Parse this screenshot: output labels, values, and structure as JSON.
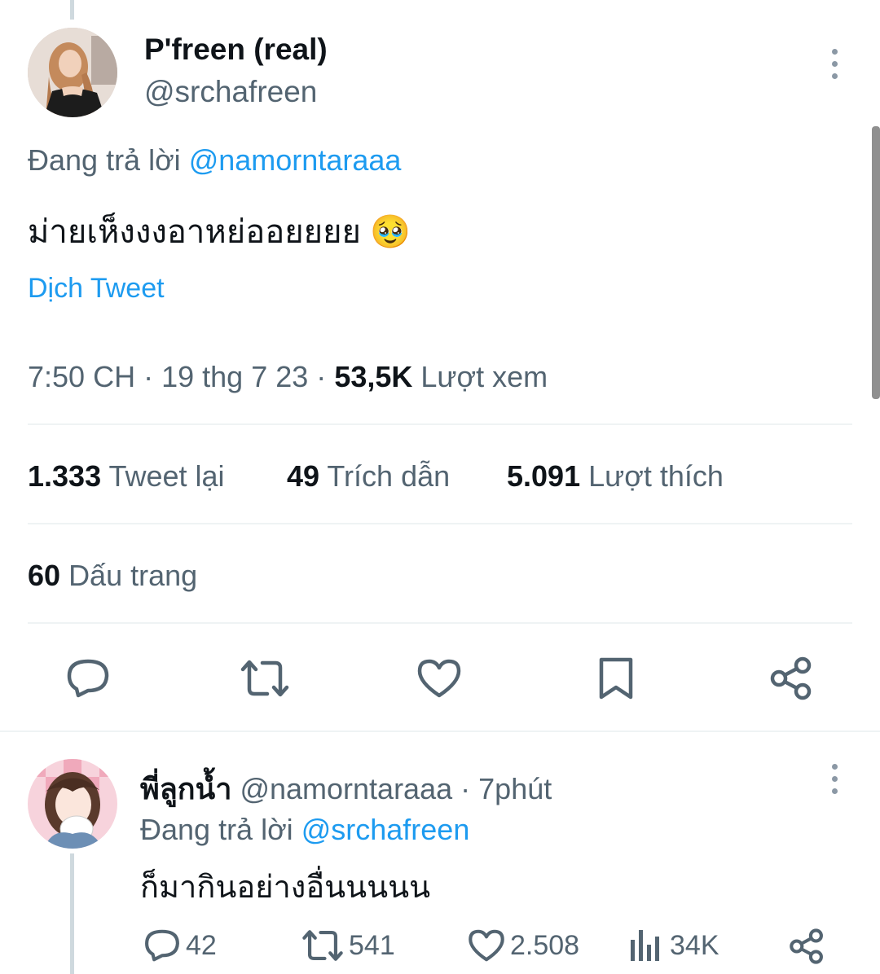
{
  "main_tweet": {
    "display_name": "P'freen (real)",
    "handle": "@srchafreen",
    "reply_prefix": "Đang trả lời",
    "reply_to": "@namorntaraaa",
    "text": "ม่ายเห็งงงอาหย่ออยยยย",
    "emoji": "🥹",
    "translate": "Dịch Tweet",
    "time": "7:50 CH",
    "date": "19 thg 7 23",
    "views_count": "53,5K",
    "views_label": "Lượt xem",
    "sep": "·",
    "stats": {
      "retweets_count": "1.333",
      "retweets_label": "Tweet lại",
      "quotes_count": "49",
      "quotes_label": "Trích dẫn",
      "likes_count": "5.091",
      "likes_label": "Lượt thích",
      "bookmarks_count": "60",
      "bookmarks_label": "Dấu trang"
    }
  },
  "reply_tweet": {
    "display_name": "พี่ลูกน้ำ",
    "handle": "@namorntaraaa",
    "sep": "·",
    "time": "7phút",
    "reply_prefix": "Đang trả lời",
    "reply_to": "@srchafreen",
    "text": "ก็มากินอย่างอื่นนนนน",
    "replies": "42",
    "retweets": "541",
    "likes": "2.508",
    "views": "34K"
  },
  "colors": {
    "link": "#1d9bf0",
    "muted": "#536471",
    "text": "#0f1419",
    "divider": "#eff3f4"
  }
}
